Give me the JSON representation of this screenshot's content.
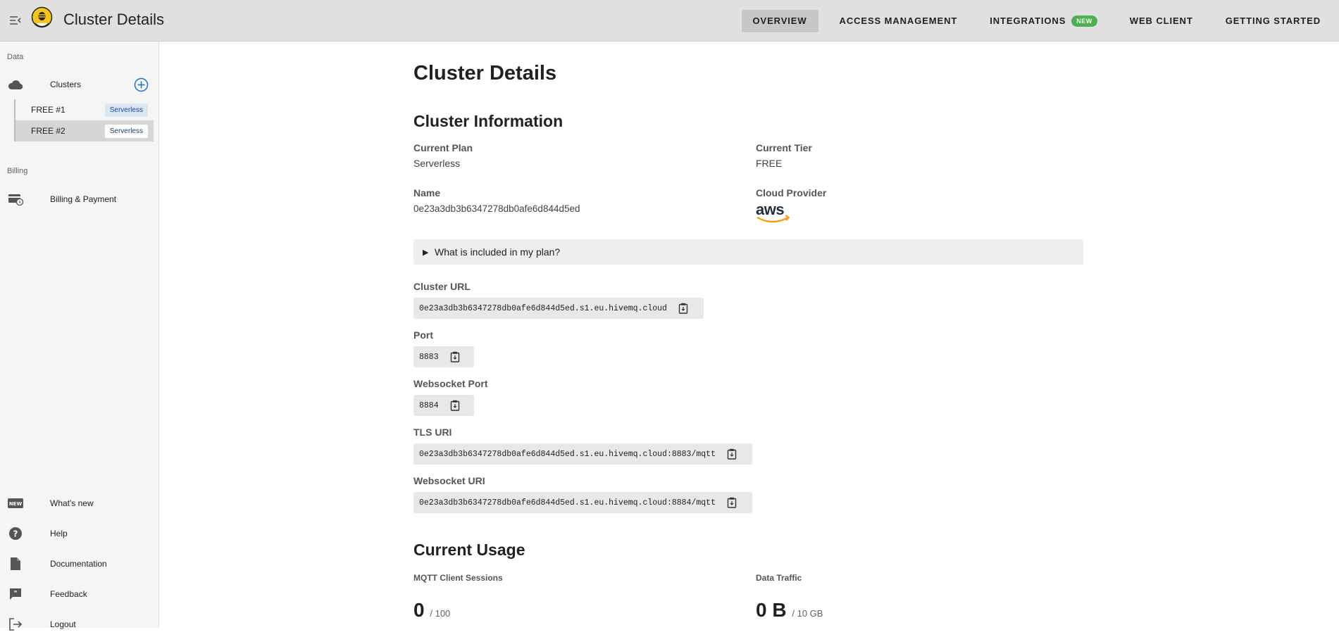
{
  "header": {
    "title": "Cluster Details",
    "tabs": [
      {
        "label": "OVERVIEW",
        "active": true
      },
      {
        "label": "ACCESS MANAGEMENT",
        "active": false
      },
      {
        "label": "INTEGRATIONS",
        "active": false,
        "badge": "NEW"
      },
      {
        "label": "WEB CLIENT",
        "active": false
      },
      {
        "label": "GETTING STARTED",
        "active": false
      }
    ]
  },
  "sidebar": {
    "data_section": "Data",
    "clusters_label": "Clusters",
    "clusters": [
      {
        "name": "FREE #1",
        "type": "Serverless",
        "selected": false
      },
      {
        "name": "FREE #2",
        "type": "Serverless",
        "selected": true
      }
    ],
    "billing_section": "Billing",
    "billing_label": "Billing & Payment",
    "bottom_items": [
      {
        "label": "What's new",
        "icon": "new-icon"
      },
      {
        "label": "Help",
        "icon": "help-icon"
      },
      {
        "label": "Documentation",
        "icon": "document-icon"
      },
      {
        "label": "Feedback",
        "icon": "feedback-icon"
      },
      {
        "label": "Logout",
        "icon": "logout-icon"
      }
    ]
  },
  "main": {
    "page_title": "Cluster Details",
    "info_title": "Cluster Information",
    "current_plan_label": "Current Plan",
    "current_plan_value": "Serverless",
    "current_tier_label": "Current Tier",
    "current_tier_value": "FREE",
    "name_label": "Name",
    "name_value": "0e23a3db3b6347278db0afe6d844d5ed",
    "cloud_provider_label": "Cloud Provider",
    "cloud_provider_value": "aws",
    "plan_toggle": "What is included in my plan?",
    "cluster_url_label": "Cluster URL",
    "cluster_url_value": "0e23a3db3b6347278db0afe6d844d5ed.s1.eu.hivemq.cloud",
    "port_label": "Port",
    "port_value": "8883",
    "ws_port_label": "Websocket Port",
    "ws_port_value": "8884",
    "tls_uri_label": "TLS URI",
    "tls_uri_value": "0e23a3db3b6347278db0afe6d844d5ed.s1.eu.hivemq.cloud:8883/mqtt",
    "ws_uri_label": "Websocket URI",
    "ws_uri_value": "0e23a3db3b6347278db0afe6d844d5ed.s1.eu.hivemq.cloud:8884/mqtt",
    "usage_title": "Current Usage",
    "sessions_label": "MQTT Client Sessions",
    "sessions_value": "0",
    "sessions_limit": "/ 100",
    "traffic_label": "Data Traffic",
    "traffic_value": "0 B",
    "traffic_limit": "/ 10 GB"
  },
  "colors": {
    "accent": "#4caf50",
    "chip_text": "#0d47a1",
    "add_icon": "#1e6fc0"
  }
}
